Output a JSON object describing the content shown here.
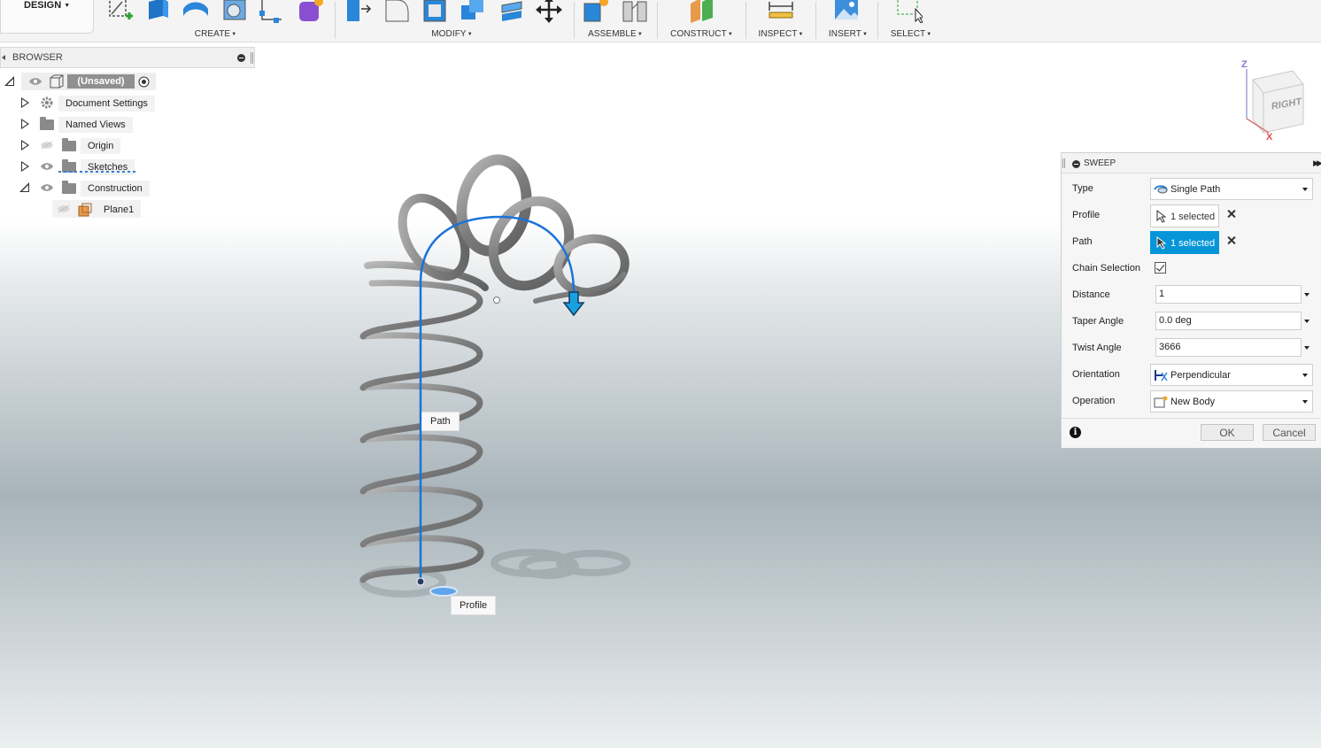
{
  "toolbar": {
    "workspace": "DESIGN",
    "groups": [
      {
        "label": "CREATE"
      },
      {
        "label": "MODIFY"
      },
      {
        "label": "ASSEMBLE"
      },
      {
        "label": "CONSTRUCT"
      },
      {
        "label": "INSPECT"
      },
      {
        "label": "INSERT"
      },
      {
        "label": "SELECT"
      }
    ]
  },
  "browser": {
    "title": "BROWSER",
    "root": "(Unsaved)",
    "items": [
      {
        "label": "Document Settings"
      },
      {
        "label": "Named Views"
      },
      {
        "label": "Origin"
      },
      {
        "label": "Sketches"
      },
      {
        "label": "Construction"
      },
      {
        "label": "Plane1"
      }
    ]
  },
  "viewcube": {
    "face": "RIGHT",
    "axis_z": "Z",
    "axis_x": "X"
  },
  "viewport": {
    "path_label": "Path",
    "profile_label": "Profile"
  },
  "sweep": {
    "title": "SWEEP",
    "type_label": "Type",
    "type_value": "Single Path",
    "profile_label": "Profile",
    "profile_value": "1 selected",
    "path_label": "Path",
    "path_value": "1 selected",
    "chain_label": "Chain Selection",
    "chain_checked": true,
    "distance_label": "Distance",
    "distance_value": "1",
    "taper_label": "Taper Angle",
    "taper_value": "0.0 deg",
    "twist_label": "Twist Angle",
    "twist_value": "3666",
    "orientation_label": "Orientation",
    "orientation_value": "Perpendicular",
    "operation_label": "Operation",
    "operation_value": "New Body",
    "ok": "OK",
    "cancel": "Cancel"
  },
  "colors": {
    "accent": "#0696d7",
    "path_blue": "#1a73d9",
    "shape_gray": "#8e8e8e"
  }
}
